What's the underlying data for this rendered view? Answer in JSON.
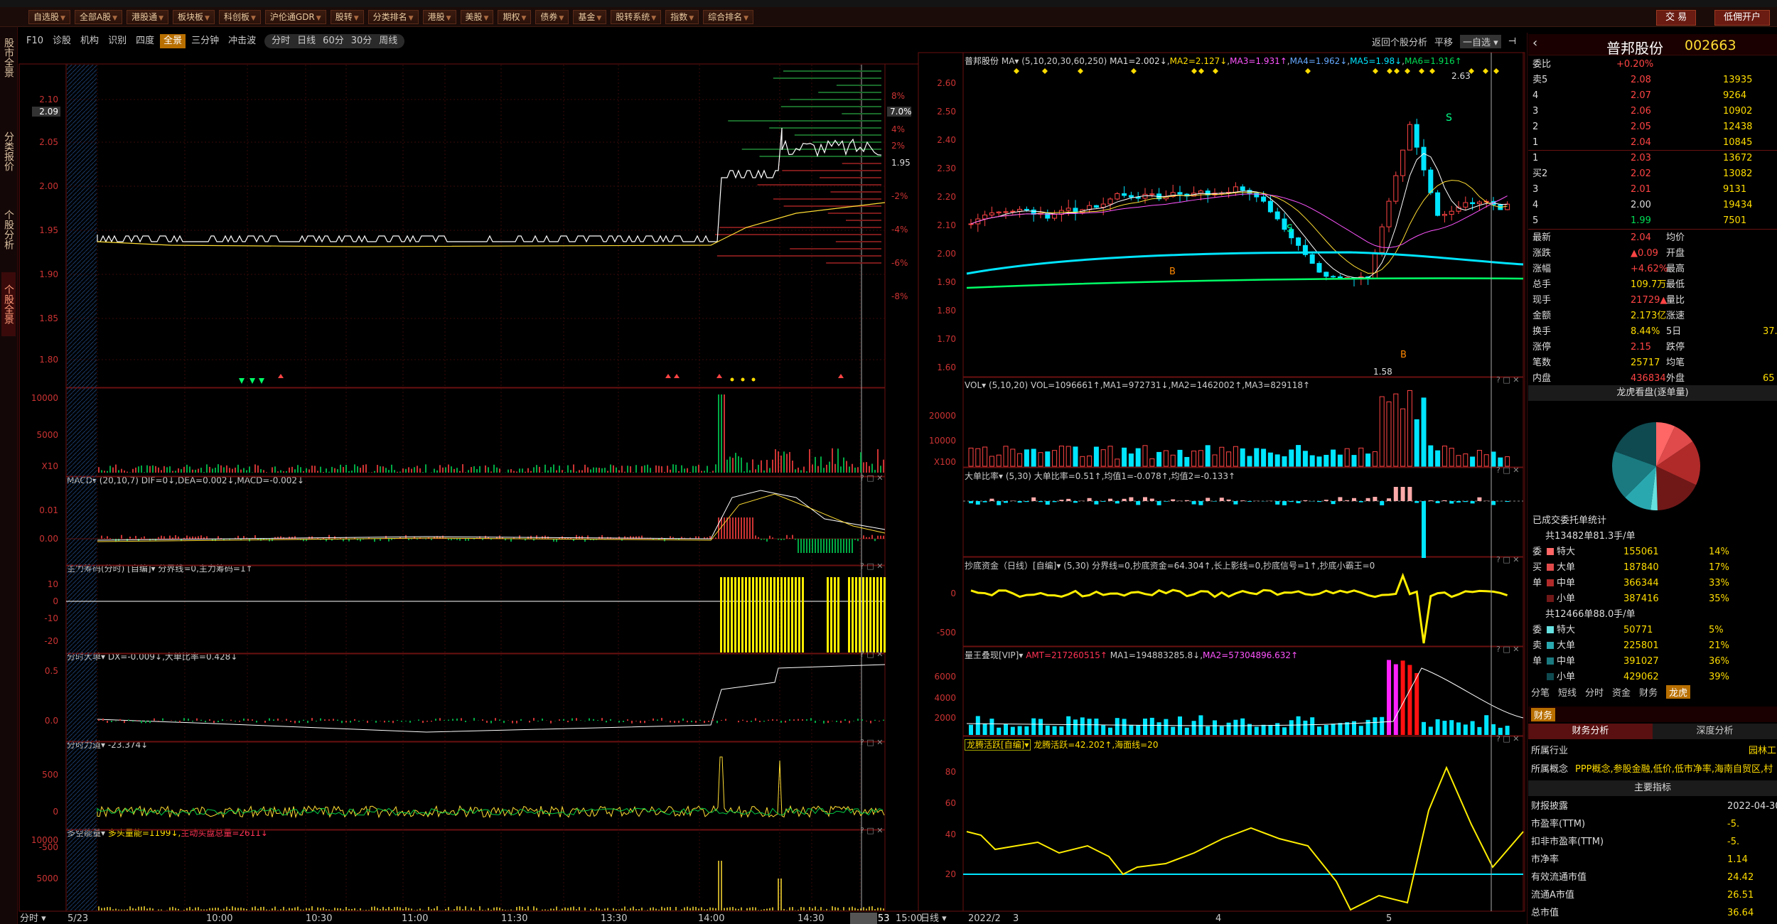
{
  "toolbar": {
    "buttons": [
      "自选股",
      "全部A股",
      "港股通",
      "板块板",
      "科创板",
      "沪伦通GDR",
      "股转",
      "分类排名",
      "港股",
      "美股",
      "期权",
      "债券",
      "基金",
      "股转系统",
      "指数",
      "综合排名"
    ],
    "trade": "交 易",
    "open_account": "低佣开户"
  },
  "left_strip": {
    "tabs": [
      "股市全景",
      "分类报价",
      "个股分析",
      "个股全景"
    ]
  },
  "subtabs": {
    "items": [
      "F10",
      "诊股",
      "机构",
      "识别",
      "四度",
      "全景",
      "三分钟",
      "冲击波"
    ],
    "active": "全景",
    "periods": [
      "分时",
      "日线",
      "60分",
      "30分",
      "周线"
    ]
  },
  "intraday": {
    "price_ticks": [
      "2.10",
      "2.05",
      "2.00",
      "1.95",
      "1.90",
      "1.85",
      "1.80"
    ],
    "current_price_tag": "2.09",
    "pct_ticks": [
      "8%",
      "6%",
      "4%",
      "2%",
      "1.95",
      "-2%",
      "-4%",
      "-6%",
      "-8%"
    ],
    "pct_tag": "7.0%",
    "vol_ticks": [
      "10000",
      "5000",
      "X10"
    ],
    "macd_hdr": "MACD▾ (20,10,7) DIF=0↓,DEA=0.002↓,MACD=-0.002↓",
    "macd_ticks": [
      "0.01",
      "0.00"
    ],
    "zlcm_hdr": "主力筹码(分时) [自编]▾ 分界线=0,主力筹码=1↑",
    "zlcm_ticks": [
      "10",
      "0",
      "-10",
      "-20"
    ],
    "fsdd_hdr": "分时大单▾ DX=-0.009↓,大单比率=0.428↓",
    "fsdd_ticks": [
      "0.5",
      "0.0"
    ],
    "fsld_hdr": "分时力道▾ -23.374↓",
    "fsld_ticks": [
      "500",
      "0",
      "-500"
    ],
    "dkn_hdr_a": "多空能量▾ ",
    "dkn_hdr_b": "多头量能=1199↓,",
    "dkn_hdr_c": "主动买盘总量=2611↓",
    "dkn_ticks": [
      "10000",
      "5000"
    ],
    "time_ticks": [
      "分时 ▾",
      "5/23",
      "10:00",
      "10:30",
      "11:00",
      "11:30",
      "13:30",
      "14:00",
      "14:30",
      "14:53",
      "15:00"
    ]
  },
  "daily": {
    "nav": {
      "back": "返回个股分析",
      "flat": "平移",
      "custom": "一自选 ▾"
    },
    "hdr_name": "普邦股份",
    "hdr_ma": "MA▾ (5,10,20,30,60,250)",
    "hdr_values": [
      "MA1=2.002↓",
      "MA2=2.127↓",
      "MA3=1.931↑",
      "MA4=1.962↓",
      "MA5=1.98↓",
      "MA6=1.916↑"
    ],
    "price_ticks": [
      "2.60",
      "2.50",
      "2.40",
      "2.30",
      "2.20",
      "2.10",
      "2.00",
      "1.90",
      "1.80",
      "1.70",
      "1.60"
    ],
    "hi_label": "2.63",
    "lo_label": "1.58",
    "s_label": "S",
    "b_label": "B",
    "vol_hdr": "VOL▾ (5,10,20) VOL=1096661↑,MA1=972731↓,MA2=1462002↑,MA3=829118↑",
    "vol_ticks": [
      "20000",
      "10000",
      "X100"
    ],
    "ddbl_hdr": "大单比率▾ (5,30) 大单比率=0.51↑,均值1=-0.078↑,均值2=-0.133↑",
    "cdzj_hdr": "抄底资金（日线）[自编]▾ (5,30) 分界线=0,抄底资金=64.304↑,长上影线=0,抄底信号=1↑,抄底小霸王=0",
    "cdzj_ticks": [
      "0",
      "-500"
    ],
    "lwdx_hdr_a": "量王叠现[VIP]▾ ",
    "lwdx_hdr_b": "AMT=217260515↑",
    "lwdx_hdr_c": " MA1=194883285.8↓,",
    "lwdx_hdr_d": "MA2=57304896.632↑",
    "lwdx_ticks": [
      "6000",
      "4000",
      "2000"
    ],
    "lthy_hdr_a": "龙腾活跃[自编]▾",
    "lthy_hdr_b": "龙腾活跃=42.202↑,海面线=20",
    "lthy_ticks": [
      "80",
      "60",
      "40",
      "20"
    ],
    "date_ticks": [
      "日线 ▾",
      "2022/2",
      "3",
      "4",
      "5"
    ]
  },
  "quote": {
    "name": "普邦股份",
    "code": "002663",
    "webi_label": "委比",
    "webi_value": "+0.20%",
    "sell_labels": [
      "卖5",
      "4",
      "3",
      "2",
      "1"
    ],
    "sell_prices": [
      "2.08",
      "2.07",
      "2.06",
      "2.05",
      "2.04"
    ],
    "sell_vols": [
      "13935",
      "9264",
      "10902",
      "12438",
      "10845"
    ],
    "buy_labels": [
      "1",
      "买2",
      "3",
      "4",
      "5"
    ],
    "buy_prices": [
      "2.03",
      "2.02",
      "2.01",
      "2.00",
      "1.99"
    ],
    "buy_vols": [
      "13672",
      "13082",
      "9131",
      "19434",
      "7501"
    ],
    "stats": [
      [
        "最新",
        "2.04",
        "均价",
        ""
      ],
      [
        "涨跌",
        "▲0.09",
        "开盘",
        ""
      ],
      [
        "涨幅",
        "+4.62%",
        "最高",
        ""
      ],
      [
        "总手",
        "109.7万",
        "最低",
        ""
      ],
      [
        "现手",
        "21729▲",
        "量比",
        ""
      ],
      [
        "金额",
        "2.173亿",
        "涨速",
        ""
      ],
      [
        "换手",
        "8.44%",
        "5日",
        "37."
      ],
      [
        "涨停",
        "2.15",
        "跌停",
        ""
      ],
      [
        "笔数",
        "25717",
        "均笔",
        ""
      ],
      [
        "内盘",
        "436834",
        "外盘",
        "65"
      ]
    ],
    "lh_title": "龙虎看盘(逐单量)",
    "order_stat_title": "已成交委托单统计",
    "buy_total": "共13482单81.3手/单",
    "buy_rows": [
      [
        "委",
        "特大",
        "155061",
        "14%"
      ],
      [
        "买",
        "大单",
        "187840",
        "17%"
      ],
      [
        "单",
        "中单",
        "366344",
        "33%"
      ],
      [
        "",
        "小单",
        "387416",
        "35%"
      ]
    ],
    "sell_total": "共12466单88.0手/单",
    "sell_rows": [
      [
        "委",
        "特大",
        "50771",
        "5%"
      ],
      [
        "卖",
        "大单",
        "225801",
        "21%"
      ],
      [
        "单",
        "中单",
        "391027",
        "36%"
      ],
      [
        "",
        "小单",
        "429062",
        "39%"
      ]
    ],
    "tabs1": [
      "分笔",
      "短线",
      "分时",
      "资金",
      "财务",
      "龙虎"
    ],
    "tabs1_active": "龙虎",
    "fin_tab": "财务",
    "fin_tabs": [
      "财务分析",
      "深度分析"
    ],
    "industry_label": "所属行业",
    "industry_value": "园林工",
    "concept_label": "所属概念",
    "concept_value": "PPP概念,参股金融,低价,低市净率,海南自贸区,村",
    "main_index": "主要指标",
    "fin_rows": [
      [
        "财报披露",
        "2022-04-30"
      ],
      [
        "市盈率(TTM)",
        "-5."
      ],
      [
        "扣非市盈率(TTM)",
        "-5."
      ],
      [
        "市净率",
        "1.14"
      ],
      [
        "有效流通市值",
        "24.42"
      ],
      [
        "流通A市值",
        "26.51"
      ],
      [
        "总市值",
        "36.64"
      ]
    ],
    "pie": [
      {
        "name": "特大买",
        "value": 14,
        "color": "#ff6666"
      },
      {
        "name": "大单买",
        "value": 17,
        "color": "#e04a4a"
      },
      {
        "name": "中单买",
        "value": 33,
        "color": "#b02a2a"
      },
      {
        "name": "小单买",
        "value": 35,
        "color": "#701818"
      },
      {
        "name": "特大卖",
        "value": 5,
        "color": "#66e0e0"
      },
      {
        "name": "大单卖",
        "value": 21,
        "color": "#2aa8b0"
      },
      {
        "name": "中单卖",
        "value": 36,
        "color": "#1a7a80"
      },
      {
        "name": "小单卖",
        "value": 39,
        "color": "#0e4a50"
      }
    ]
  }
}
